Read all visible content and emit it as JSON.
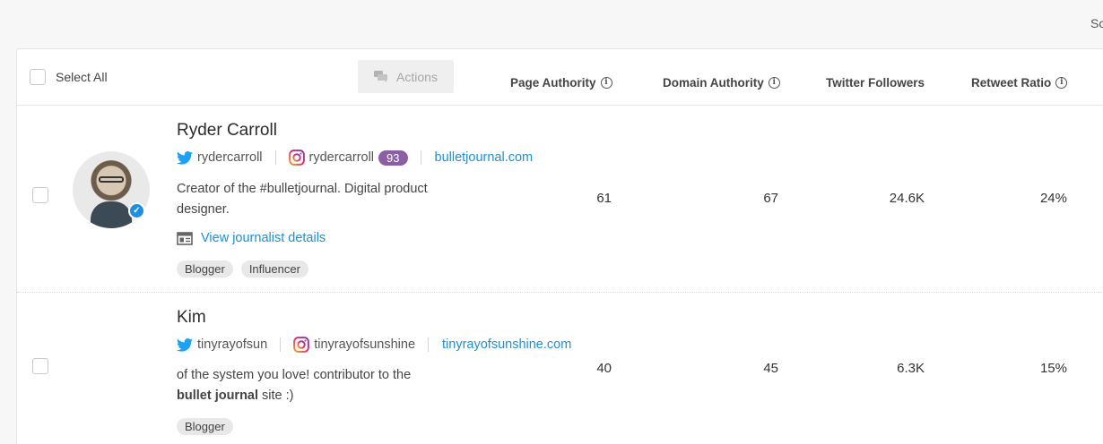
{
  "corner_text": "Sc",
  "header": {
    "select_all_label": "Select All",
    "actions_label": "Actions",
    "columns": [
      {
        "label": "Page Authority",
        "info": true
      },
      {
        "label": "Domain Authority",
        "info": true
      },
      {
        "label": "Twitter Followers",
        "info": false
      },
      {
        "label": "Retweet Ratio",
        "info": true
      }
    ]
  },
  "rows": [
    {
      "name": "Ryder Carroll",
      "twitter": "rydercarroll",
      "instagram": "rydercarroll",
      "instagram_badge": "93",
      "website": "bulletjournal.com",
      "bio": "Creator of the #bulletjournal. Digital product designer.",
      "details_link": "View journalist details",
      "tags": [
        "Blogger",
        "Influencer"
      ],
      "page_authority": "61",
      "domain_authority": "67",
      "twitter_followers": "24.6K",
      "retweet_ratio": "24%",
      "verified": true
    },
    {
      "name": "Kim",
      "twitter": "tinyrayofsun",
      "instagram": "tinyrayofsunshine",
      "website": "tinyrayofsunshine.com",
      "bio_pre": "of the system you love! contributor to the",
      "bio_bold": "bullet journal",
      "bio_post": " site :)",
      "tags": [
        "Blogger"
      ],
      "page_authority": "40",
      "domain_authority": "45",
      "twitter_followers": "6.3K",
      "retweet_ratio": "15%"
    }
  ],
  "colors": {
    "link": "#1f8fd0",
    "badge": "#8c5ea6",
    "twitter": "#1da1f2",
    "verified": "#1d8fe0"
  }
}
